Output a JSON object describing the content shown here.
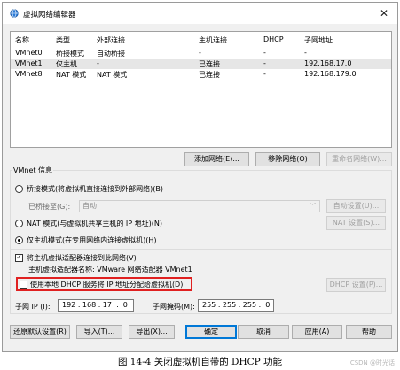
{
  "window": {
    "title": "虚拟网络编辑器",
    "close": "✕"
  },
  "network_list": {
    "columns": [
      "名称",
      "类型",
      "外部连接",
      "主机连接",
      "DHCP",
      "子网地址"
    ],
    "rows": [
      [
        "VMnet0",
        "桥接模式",
        "自动桥接",
        "-",
        "-",
        "-"
      ],
      [
        "VMnet1",
        "仅主机...",
        "-",
        "已连接",
        "-",
        "192.168.17.0"
      ],
      [
        "VMnet8",
        "NAT 模式",
        "NAT 模式",
        "已连接",
        "-",
        "192.168.179.0"
      ]
    ],
    "selected_row": 1
  },
  "list_buttons": {
    "add": "添加网络(E)...",
    "remove": "移除网络(O)",
    "rename": "重命名网络(W)..."
  },
  "vmnet_info": {
    "legend": "VMnet 信息",
    "bridged": {
      "label": "桥接模式(将虚拟机直接连接到外部网络)(B)",
      "checked": false
    },
    "bridged_to_label": "已桥接至(G):",
    "bridged_to_value": "自动",
    "auto_settings": "自动设置(U)...",
    "nat": {
      "label": "NAT 模式(与虚拟机共享主机的 IP 地址)(N)",
      "checked": false
    },
    "nat_settings": "NAT 设置(S)...",
    "hostonly": {
      "label": "仅主机模式(在专用网络内连接虚拟机)(H)",
      "checked": true
    },
    "connect_host": {
      "label": "将主机虚拟适配器连接到此网络(V)",
      "checked": true
    },
    "adapter_name": "主机虚拟适配器名称: VMware 网络适配器 VMnet1",
    "use_dhcp": {
      "label": "使用本地 DHCP 服务将 IP 地址分配给虚拟机(D)",
      "checked": false
    },
    "dhcp_settings": "DHCP 设置(P)...",
    "subnet_ip_label": "子网 IP (I):",
    "subnet_ip": "192 . 168 . 17  .  0",
    "subnet_mask_label": "子网掩码(M):",
    "subnet_mask": "255 . 255 . 255 .  0"
  },
  "bottom_buttons": {
    "restore": "还原默认设置(R)",
    "import": "导入(T)...",
    "export": "导出(X)...",
    "ok": "确定",
    "cancel": "取消",
    "apply": "应用(A)",
    "help": "帮助"
  },
  "caption": "图 14-4   关闭虚拟机自带的 DHCP 功能",
  "watermark": "CSDN @时光话"
}
